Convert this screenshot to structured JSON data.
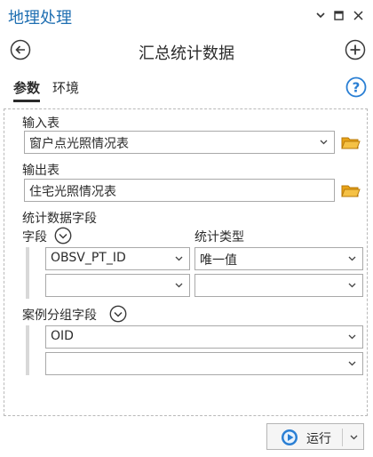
{
  "window": {
    "title": "地理处理"
  },
  "tool": {
    "title": "汇总统计数据"
  },
  "tabs": [
    {
      "label": "参数",
      "active": true
    },
    {
      "label": "环境",
      "active": false
    }
  ],
  "params": {
    "input_table": {
      "label": "输入表",
      "value": "窗户点光照情况表"
    },
    "output_table": {
      "label": "输出表",
      "value": "住宅光照情况表"
    },
    "stat_fields": {
      "label": "统计数据字段",
      "field_col_label": "字段",
      "type_col_label": "统计类型",
      "rows": [
        {
          "field": "OBSV_PT_ID",
          "type": "唯一值"
        },
        {
          "field": "",
          "type": ""
        }
      ]
    },
    "case_fields": {
      "label": "案例分组字段",
      "rows": [
        {
          "field": "OID"
        },
        {
          "field": ""
        }
      ]
    }
  },
  "footer": {
    "run_label": "运行"
  },
  "colors": {
    "title_blue": "#1f6fb2",
    "folder_yellow": "#e8a317",
    "run_icon_blue": "#2a7fd4"
  },
  "icons": [
    "close-icon",
    "maximize-icon",
    "dropdown-icon",
    "back-icon",
    "add-icon",
    "help-icon",
    "folder-icon",
    "expand-icon",
    "run-icon"
  ]
}
